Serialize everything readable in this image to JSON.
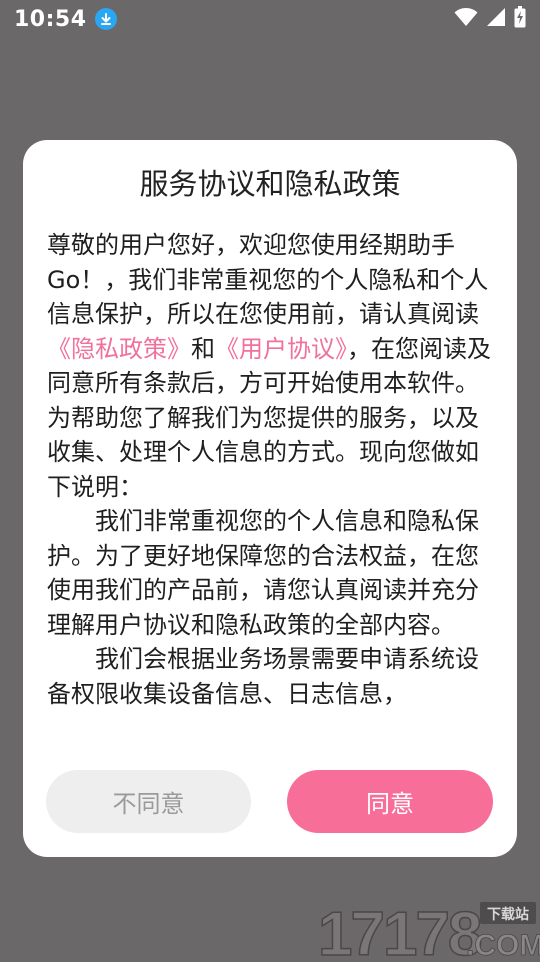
{
  "status_bar": {
    "time": "10:54",
    "icons": [
      "download-icon",
      "wifi-icon",
      "cellular-signal-icon",
      "battery-charging-icon"
    ]
  },
  "dialog": {
    "title": "服务协议和隐私政策",
    "intro": {
      "p1_before": "尊敬的用户您好，欢迎您使用经期助手Go！，我们非常重视您的个人隐私和个人信息保护，所以在您使用前，请认真阅读",
      "privacy_link": "《隐私政策》",
      "and": "和",
      "user_link": "《用户协议》",
      "p1_after": "，在您阅读及同意所有条款后，方可开始使用本软件。"
    },
    "paragraphs": [
      "为帮助您了解我们为您提供的服务，以及收集、处理个人信息的方式。现向您做如下说明：",
      "我们非常重视您的个人信息和隐私保护。为了更好地保障您的合法权益，在您使用我们的产品前，请您认真阅读并充分理解用户协议和隐私政策的全部内容。",
      "我们会根据业务场景需要申请系统设备权限收集设备信息、日志信息，"
    ],
    "buttons": {
      "disagree": "不同意",
      "agree": "同意"
    }
  },
  "watermark": {
    "number": "17178",
    "domain": ".COM",
    "tag": "下载站"
  },
  "colors": {
    "accent": "#f76f99",
    "link": "#f0719c",
    "overlay": "#6b6869"
  }
}
